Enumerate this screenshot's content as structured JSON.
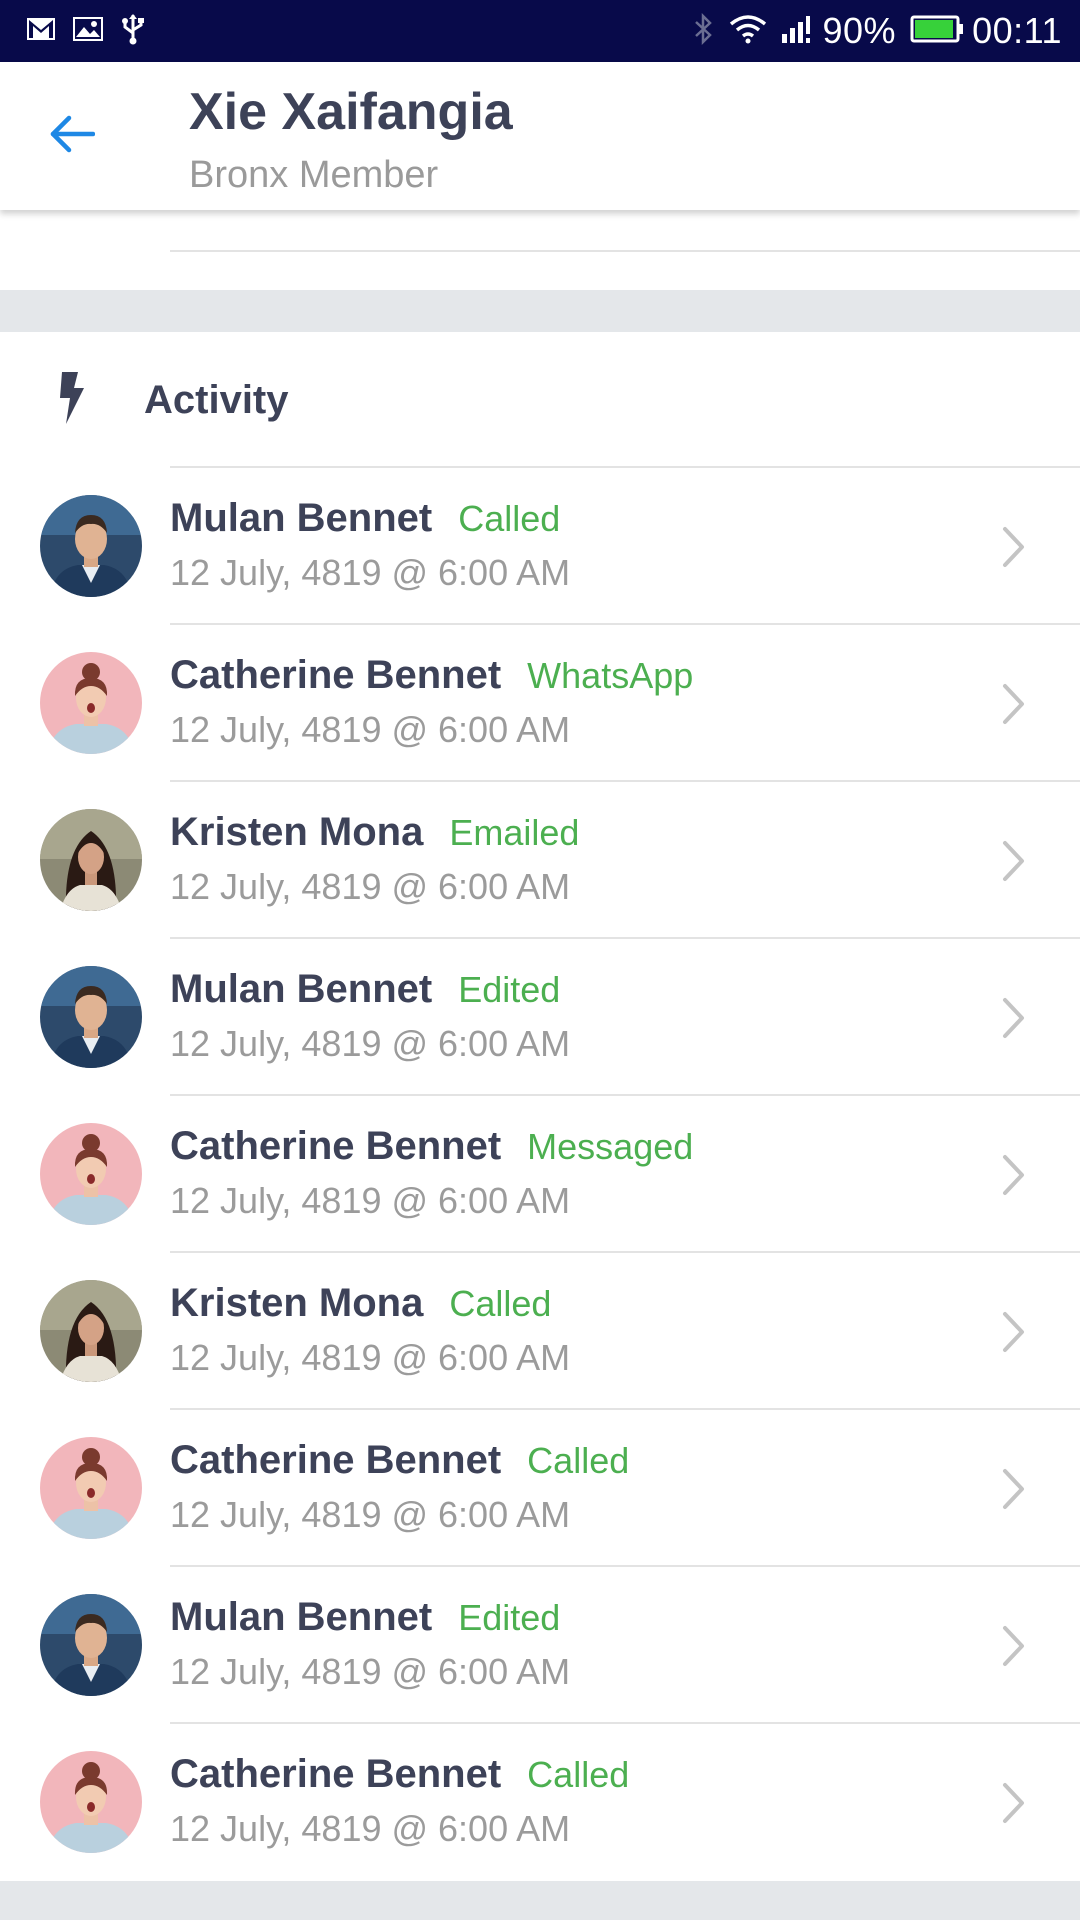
{
  "status_bar": {
    "battery_percent": "90%",
    "time": "00:11",
    "icons": [
      "gmail-icon",
      "image-icon",
      "usb-icon",
      "bluetooth-icon",
      "wifi-icon",
      "signal-icon",
      "battery-icon"
    ]
  },
  "header": {
    "title": "Xie Xaifangia",
    "subtitle": "Bronx Member"
  },
  "activity": {
    "title": "Activity",
    "items": [
      {
        "name": "Mulan Bennet",
        "action": "Called",
        "date": "12 July, 4819 @ 6:00 AM",
        "avatar": "male"
      },
      {
        "name": "Catherine Bennet",
        "action": "WhatsApp",
        "date": "12 July, 4819 @ 6:00 AM",
        "avatar": "female-pink"
      },
      {
        "name": "Kristen Mona",
        "action": "Emailed",
        "date": "12 July, 4819 @ 6:00 AM",
        "avatar": "female-dark"
      },
      {
        "name": "Mulan Bennet",
        "action": "Edited",
        "date": "12 July, 4819 @ 6:00 AM",
        "avatar": "male"
      },
      {
        "name": "Catherine Bennet",
        "action": "Messaged",
        "date": "12 July, 4819 @ 6:00 AM",
        "avatar": "female-pink"
      },
      {
        "name": "Kristen Mona",
        "action": "Called",
        "date": "12 July, 4819 @ 6:00 AM",
        "avatar": "female-dark"
      },
      {
        "name": "Catherine Bennet",
        "action": "Called",
        "date": "12 July, 4819 @ 6:00 AM",
        "avatar": "female-pink"
      },
      {
        "name": "Mulan Bennet",
        "action": "Edited",
        "date": "12 July, 4819 @ 6:00 AM",
        "avatar": "male"
      },
      {
        "name": "Catherine Bennet",
        "action": "Called",
        "date": "12 July, 4819 @ 6:00 AM",
        "avatar": "female-pink"
      }
    ]
  },
  "colors": {
    "status_bar": "#080a4a",
    "accent_blue": "#1e88e5",
    "action_green": "#4caf50",
    "name_text": "#3d4258",
    "muted_text": "#9b9b9b",
    "section_gap": "#e4e7ea"
  }
}
